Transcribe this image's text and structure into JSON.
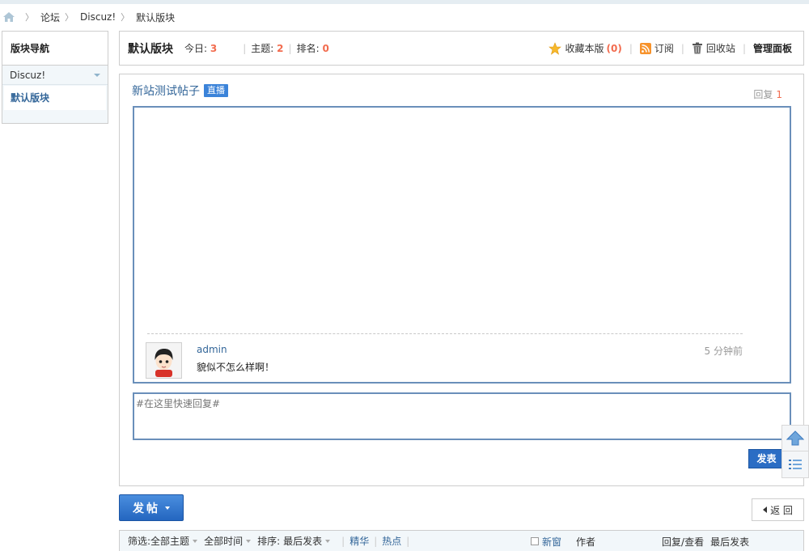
{
  "breadcrumb": {
    "items": [
      "论坛",
      "Discuz!",
      "默认版块"
    ]
  },
  "sidebar": {
    "title": "版块导航",
    "group": "Discuz!",
    "current": "默认版块"
  },
  "forum": {
    "name": "默认版块",
    "today_label": "今日:",
    "today_value": "3",
    "topics_label": "主题:",
    "topics_value": "2",
    "rank_label": "排名:",
    "rank_value": "0",
    "favorite_label": "收藏本版",
    "favorite_count": "(0)",
    "subscribe_label": "订阅",
    "recycle_label": "回收站",
    "manage_label": "管理面板"
  },
  "thread": {
    "title": "新站测试帖子",
    "badge": "直播",
    "reply_label": "回复",
    "reply_count": "1",
    "post": {
      "author": "admin",
      "time": "5 分钟前",
      "message": "貌似不怎么样啊！"
    },
    "quick_reply_placeholder": "#在这里快速回复#",
    "submit_label": "发表"
  },
  "buttons": {
    "new_post": "发帖",
    "back": "返 回"
  },
  "filter": {
    "label": "筛选:",
    "all_topics": "全部主题",
    "all_time": "全部时间",
    "sort_label": "排序:",
    "sort_value": "最后发表",
    "digest": "精华",
    "hot": "热点",
    "new_window": "新窗",
    "author": "作者",
    "replies_views": "回复/查看",
    "last_post": "最后发表"
  },
  "colors": {
    "accent": "#336699",
    "highlight_number": "#f26c4f",
    "border_blue": "#6a8fba",
    "button_blue": "#2b6dc4"
  }
}
